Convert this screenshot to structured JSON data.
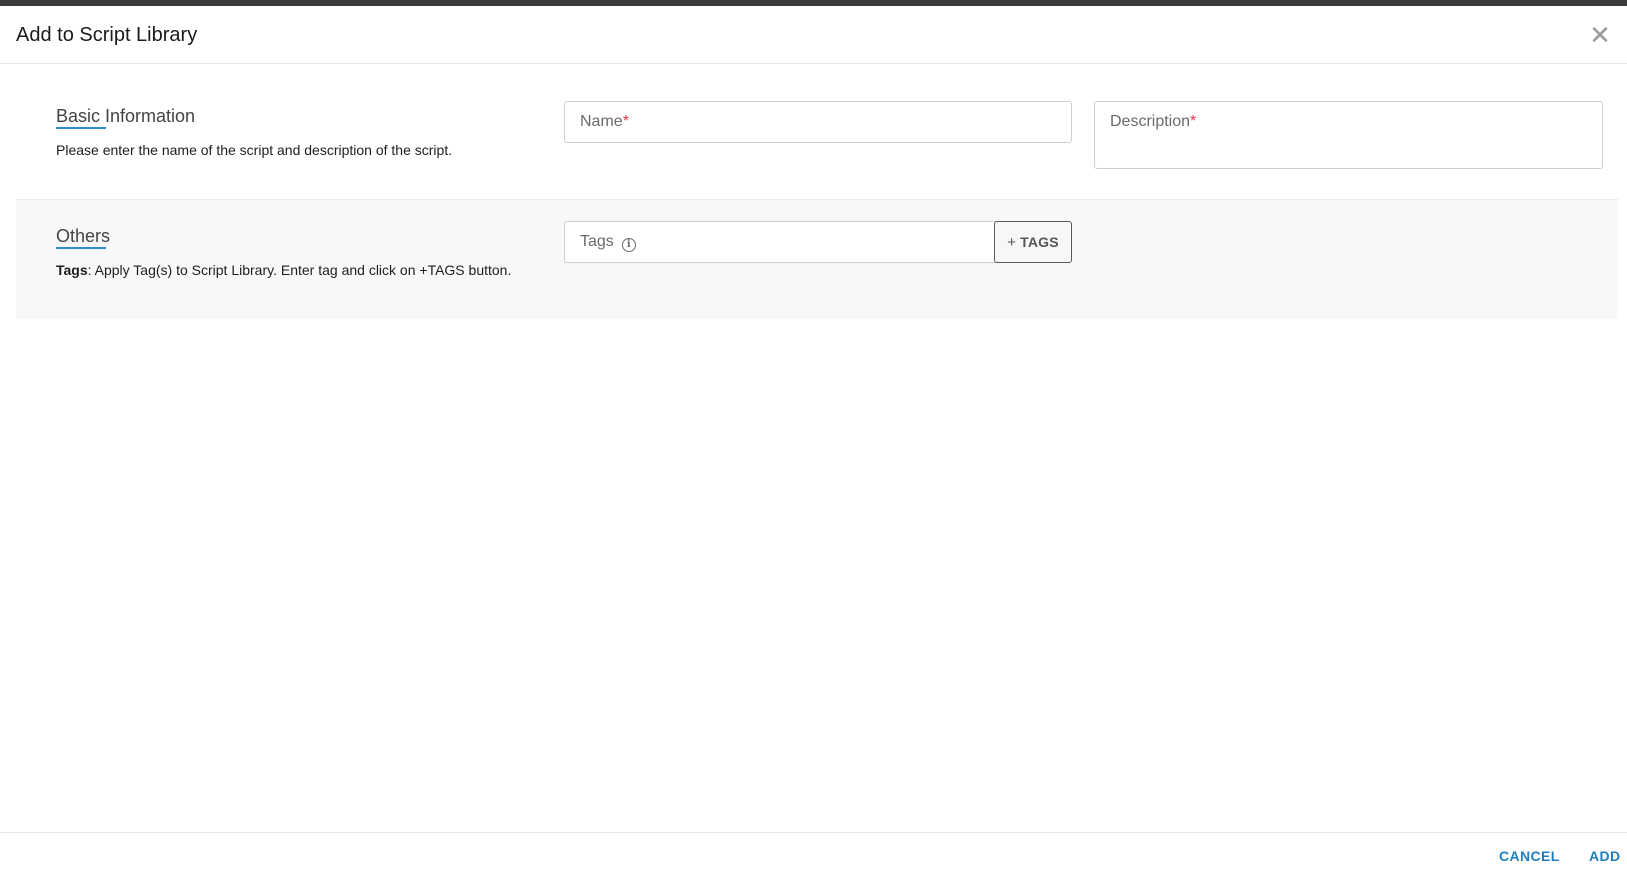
{
  "dialog": {
    "title": "Add to Script Library",
    "close_glyph": "✕"
  },
  "basic_information": {
    "heading": "Basic Information",
    "description": "Please enter the name of the script and description of the script.",
    "name_field": {
      "label": "Name",
      "required_mark": "*",
      "value": ""
    },
    "description_field": {
      "label": "Description",
      "required_mark": "*",
      "value": ""
    }
  },
  "others": {
    "heading": "Others",
    "description_bold": "Tags",
    "description_rest": ": Apply Tag(s) to Script Library. Enter tag and click on +TAGS button.",
    "tags_field": {
      "label": "Tags",
      "value": "",
      "info_icon": "info-icon"
    },
    "tags_button": {
      "plus": "+",
      "label": "TAGS"
    }
  },
  "footer": {
    "cancel_label": "CANCEL",
    "add_label": "ADD"
  },
  "colors": {
    "accent": "#1f7fbf",
    "heading_underline": "#2a8fc9",
    "required": "#e0394a",
    "top_bar": "#3a3a3a"
  }
}
